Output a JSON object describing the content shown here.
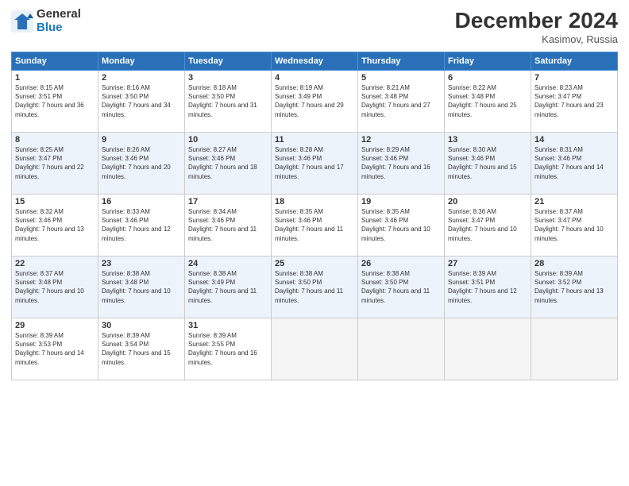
{
  "logo": {
    "general": "General",
    "blue": "Blue"
  },
  "header": {
    "month": "December 2024",
    "location": "Kasimov, Russia"
  },
  "days_of_week": [
    "Sunday",
    "Monday",
    "Tuesday",
    "Wednesday",
    "Thursday",
    "Friday",
    "Saturday"
  ],
  "weeks": [
    [
      {
        "day": 1,
        "sunrise": "Sunrise: 8:15 AM",
        "sunset": "Sunset: 3:51 PM",
        "daylight": "Daylight: 7 hours and 36 minutes."
      },
      {
        "day": 2,
        "sunrise": "Sunrise: 8:16 AM",
        "sunset": "Sunset: 3:50 PM",
        "daylight": "Daylight: 7 hours and 34 minutes."
      },
      {
        "day": 3,
        "sunrise": "Sunrise: 8:18 AM",
        "sunset": "Sunset: 3:50 PM",
        "daylight": "Daylight: 7 hours and 31 minutes."
      },
      {
        "day": 4,
        "sunrise": "Sunrise: 8:19 AM",
        "sunset": "Sunset: 3:49 PM",
        "daylight": "Daylight: 7 hours and 29 minutes."
      },
      {
        "day": 5,
        "sunrise": "Sunrise: 8:21 AM",
        "sunset": "Sunset: 3:48 PM",
        "daylight": "Daylight: 7 hours and 27 minutes."
      },
      {
        "day": 6,
        "sunrise": "Sunrise: 8:22 AM",
        "sunset": "Sunset: 3:48 PM",
        "daylight": "Daylight: 7 hours and 25 minutes."
      },
      {
        "day": 7,
        "sunrise": "Sunrise: 8:23 AM",
        "sunset": "Sunset: 3:47 PM",
        "daylight": "Daylight: 7 hours and 23 minutes."
      }
    ],
    [
      {
        "day": 8,
        "sunrise": "Sunrise: 8:25 AM",
        "sunset": "Sunset: 3:47 PM",
        "daylight": "Daylight: 7 hours and 22 minutes."
      },
      {
        "day": 9,
        "sunrise": "Sunrise: 8:26 AM",
        "sunset": "Sunset: 3:46 PM",
        "daylight": "Daylight: 7 hours and 20 minutes."
      },
      {
        "day": 10,
        "sunrise": "Sunrise: 8:27 AM",
        "sunset": "Sunset: 3:46 PM",
        "daylight": "Daylight: 7 hours and 18 minutes."
      },
      {
        "day": 11,
        "sunrise": "Sunrise: 8:28 AM",
        "sunset": "Sunset: 3:46 PM",
        "daylight": "Daylight: 7 hours and 17 minutes."
      },
      {
        "day": 12,
        "sunrise": "Sunrise: 8:29 AM",
        "sunset": "Sunset: 3:46 PM",
        "daylight": "Daylight: 7 hours and 16 minutes."
      },
      {
        "day": 13,
        "sunrise": "Sunrise: 8:30 AM",
        "sunset": "Sunset: 3:46 PM",
        "daylight": "Daylight: 7 hours and 15 minutes."
      },
      {
        "day": 14,
        "sunrise": "Sunrise: 8:31 AM",
        "sunset": "Sunset: 3:46 PM",
        "daylight": "Daylight: 7 hours and 14 minutes."
      }
    ],
    [
      {
        "day": 15,
        "sunrise": "Sunrise: 8:32 AM",
        "sunset": "Sunset: 3:46 PM",
        "daylight": "Daylight: 7 hours and 13 minutes."
      },
      {
        "day": 16,
        "sunrise": "Sunrise: 8:33 AM",
        "sunset": "Sunset: 3:46 PM",
        "daylight": "Daylight: 7 hours and 12 minutes."
      },
      {
        "day": 17,
        "sunrise": "Sunrise: 8:34 AM",
        "sunset": "Sunset: 3:46 PM",
        "daylight": "Daylight: 7 hours and 11 minutes."
      },
      {
        "day": 18,
        "sunrise": "Sunrise: 8:35 AM",
        "sunset": "Sunset: 3:46 PM",
        "daylight": "Daylight: 7 hours and 11 minutes."
      },
      {
        "day": 19,
        "sunrise": "Sunrise: 8:35 AM",
        "sunset": "Sunset: 3:46 PM",
        "daylight": "Daylight: 7 hours and 10 minutes."
      },
      {
        "day": 20,
        "sunrise": "Sunrise: 8:36 AM",
        "sunset": "Sunset: 3:47 PM",
        "daylight": "Daylight: 7 hours and 10 minutes."
      },
      {
        "day": 21,
        "sunrise": "Sunrise: 8:37 AM",
        "sunset": "Sunset: 3:47 PM",
        "daylight": "Daylight: 7 hours and 10 minutes."
      }
    ],
    [
      {
        "day": 22,
        "sunrise": "Sunrise: 8:37 AM",
        "sunset": "Sunset: 3:48 PM",
        "daylight": "Daylight: 7 hours and 10 minutes."
      },
      {
        "day": 23,
        "sunrise": "Sunrise: 8:38 AM",
        "sunset": "Sunset: 3:48 PM",
        "daylight": "Daylight: 7 hours and 10 minutes."
      },
      {
        "day": 24,
        "sunrise": "Sunrise: 8:38 AM",
        "sunset": "Sunset: 3:49 PM",
        "daylight": "Daylight: 7 hours and 11 minutes."
      },
      {
        "day": 25,
        "sunrise": "Sunrise: 8:38 AM",
        "sunset": "Sunset: 3:50 PM",
        "daylight": "Daylight: 7 hours and 11 minutes."
      },
      {
        "day": 26,
        "sunrise": "Sunrise: 8:38 AM",
        "sunset": "Sunset: 3:50 PM",
        "daylight": "Daylight: 7 hours and 11 minutes."
      },
      {
        "day": 27,
        "sunrise": "Sunrise: 8:39 AM",
        "sunset": "Sunset: 3:51 PM",
        "daylight": "Daylight: 7 hours and 12 minutes."
      },
      {
        "day": 28,
        "sunrise": "Sunrise: 8:39 AM",
        "sunset": "Sunset: 3:52 PM",
        "daylight": "Daylight: 7 hours and 13 minutes."
      }
    ],
    [
      {
        "day": 29,
        "sunrise": "Sunrise: 8:39 AM",
        "sunset": "Sunset: 3:53 PM",
        "daylight": "Daylight: 7 hours and 14 minutes."
      },
      {
        "day": 30,
        "sunrise": "Sunrise: 8:39 AM",
        "sunset": "Sunset: 3:54 PM",
        "daylight": "Daylight: 7 hours and 15 minutes."
      },
      {
        "day": 31,
        "sunrise": "Sunrise: 8:39 AM",
        "sunset": "Sunset: 3:55 PM",
        "daylight": "Daylight: 7 hours and 16 minutes."
      },
      null,
      null,
      null,
      null
    ]
  ]
}
